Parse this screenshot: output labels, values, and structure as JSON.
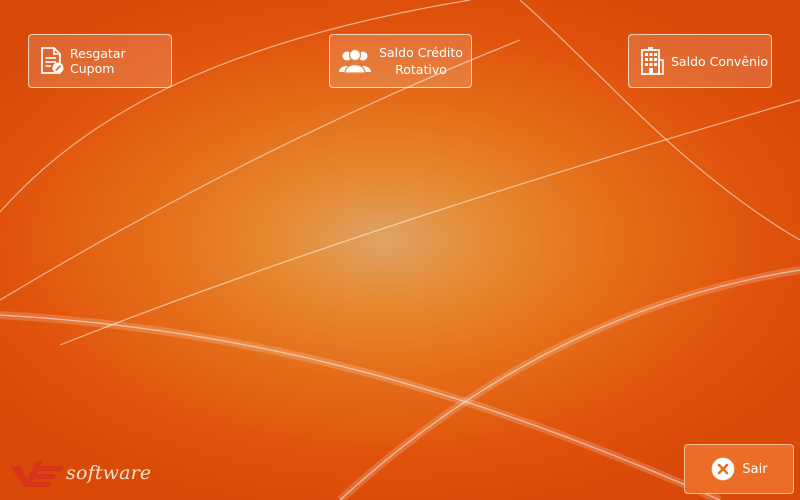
{
  "buttons": {
    "resgatar_cupom": "Resgatar Cupom",
    "saldo_credito_line1": "Saldo Crédito",
    "saldo_credito_line2": "Rotativo",
    "saldo_convenio": "Saldo Convênio",
    "sair": "Sair"
  },
  "logo": {
    "wordmark": "software"
  },
  "icons": {
    "resgatar_cupom": "document-edit-icon",
    "saldo_credito": "users-group-icon",
    "saldo_convenio": "building-icon",
    "sair": "close-circle-icon"
  },
  "colors": {
    "background": "#e56f1a",
    "logo_red": "#d8341a",
    "text": "#ffffff"
  }
}
